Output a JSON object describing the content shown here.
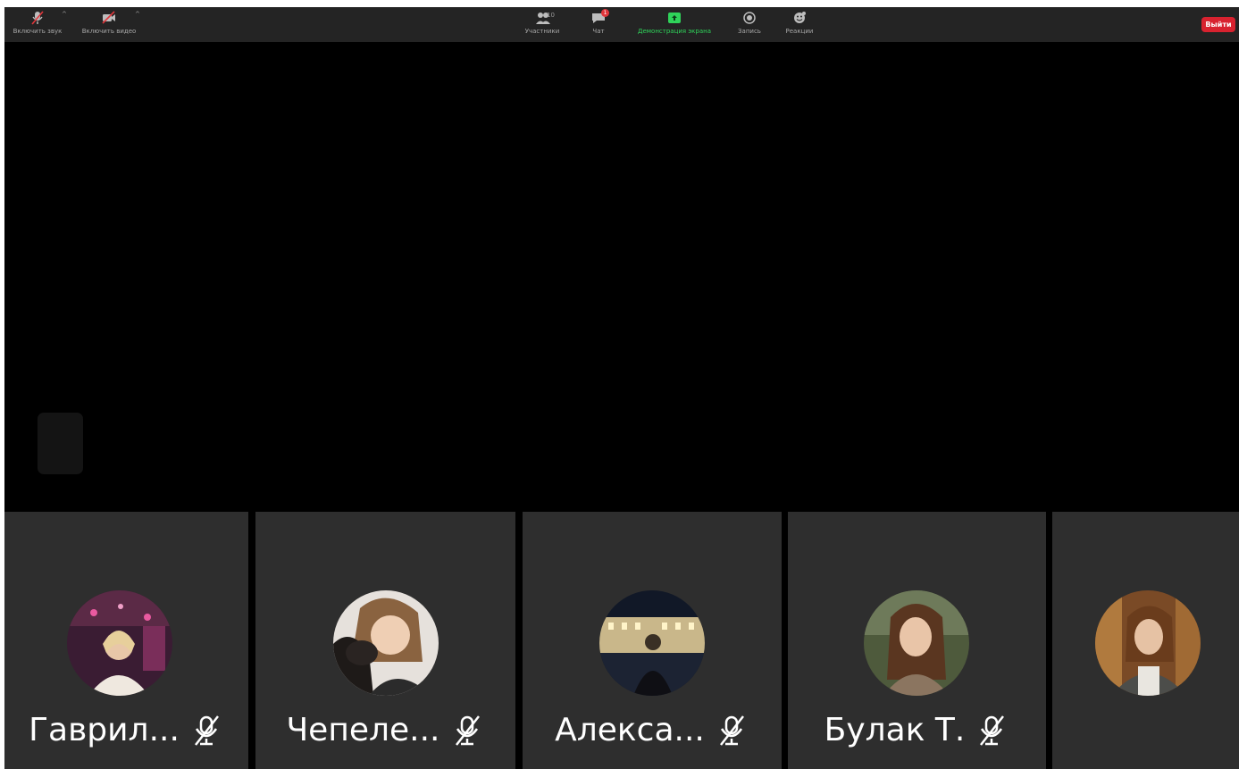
{
  "toolbar": {
    "mute_label": "Включить звук",
    "video_label": "Включить видео",
    "participants_label": "Участники",
    "participants_count": "10",
    "chat_label": "Чат",
    "chat_badge": "1",
    "share_label": "Демонстрация экрана",
    "record_label": "Запись",
    "reactions_label": "Реакции",
    "leave_label": "Выйти",
    "share_color": "#2fd35a",
    "leave_color": "#d8222f"
  },
  "gallery": {
    "participants": [
      {
        "name": "Гаврил...",
        "muted": true,
        "avatar_icon": "participant-photo"
      },
      {
        "name": "Чепеле...",
        "muted": true,
        "avatar_icon": "participant-photo"
      },
      {
        "name": "Алекса...",
        "muted": true,
        "avatar_icon": "participant-photo"
      },
      {
        "name": "Булак Т.",
        "muted": true,
        "avatar_icon": "participant-photo"
      },
      {
        "name": "",
        "muted": false,
        "avatar_icon": "participant-photo"
      }
    ]
  }
}
